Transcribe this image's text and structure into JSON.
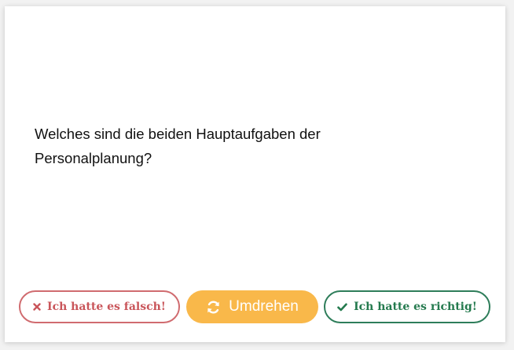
{
  "card": {
    "question": "Welches sind die beiden Hauptaufgaben der Personalplanung?"
  },
  "buttons": {
    "wrong_label": "Ich hatte es falsch!",
    "flip_label": "Umdrehen",
    "right_label": "Ich hatte es richtig!"
  },
  "icons": {
    "wrong": "x-icon",
    "flip": "refresh-icon",
    "right": "checkmark-icon"
  },
  "colors": {
    "wrong": "#c9555a",
    "flip": "#f9b84a",
    "right": "#247a4e"
  }
}
